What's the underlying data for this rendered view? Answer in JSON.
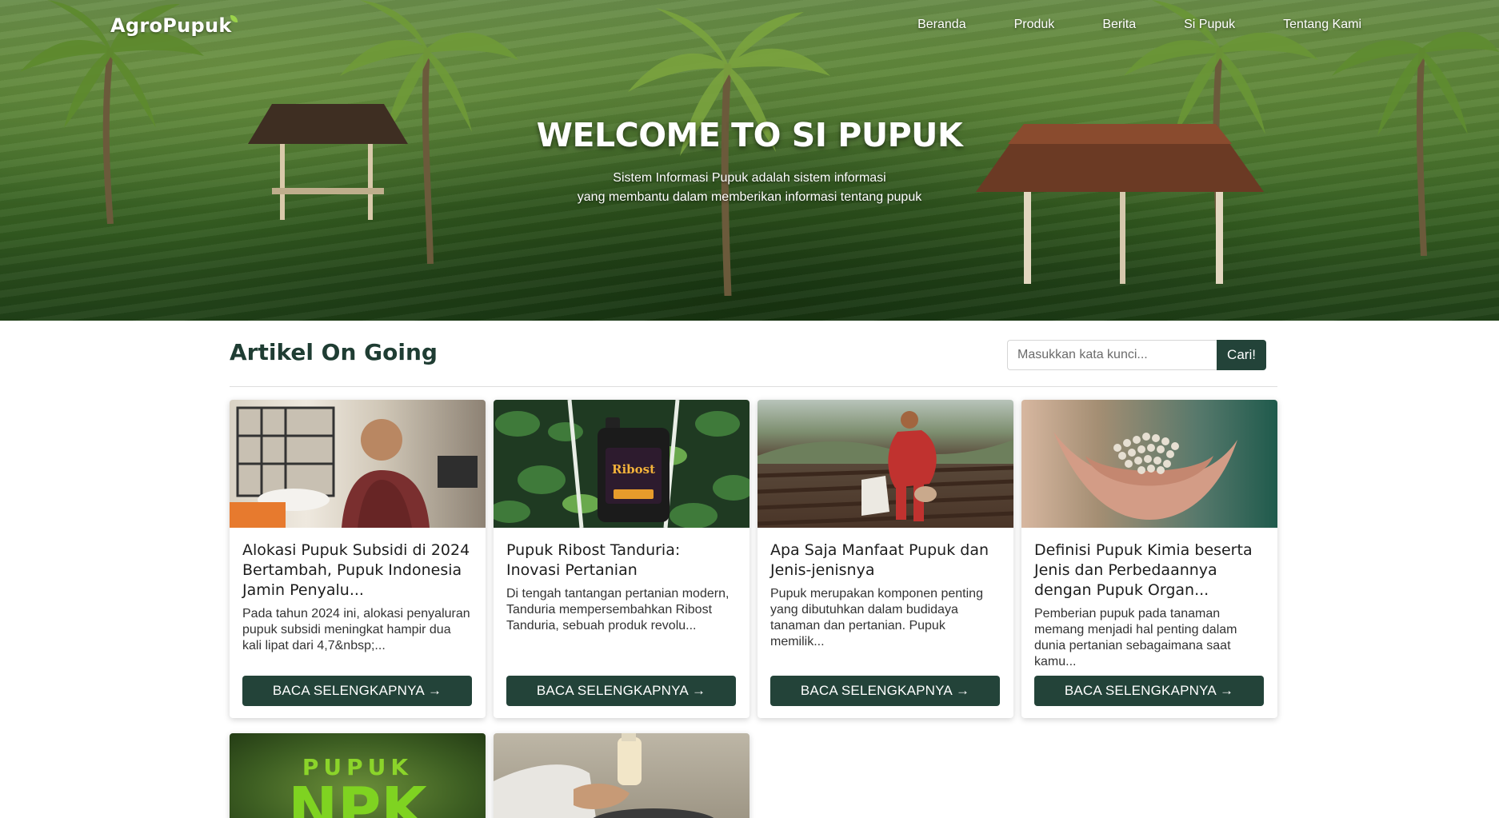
{
  "brand": {
    "name": "AgroPupuk"
  },
  "nav": {
    "items": [
      {
        "label": "Beranda"
      },
      {
        "label": "Produk"
      },
      {
        "label": "Berita"
      },
      {
        "label": "Si Pupuk"
      },
      {
        "label": "Tentang Kami"
      }
    ]
  },
  "hero": {
    "title": "WELCOME TO SI PUPUK",
    "subtitle_line1": "Sistem Informasi Pupuk adalah sistem informasi",
    "subtitle_line2": "yang membantu dalam memberikan informasi tentang pupuk"
  },
  "section": {
    "title": "Artikel On Going"
  },
  "search": {
    "placeholder": "Masukkan kata kunci...",
    "button_label": "Cari!"
  },
  "colors": {
    "primary": "#234339",
    "heading": "#1f3d33"
  },
  "articles": [
    {
      "title": "Alokasi Pupuk Subsidi di 2024 Bertambah, Pupuk Indonesia Jamin Penyalu...",
      "excerpt": "Pada tahun 2024 ini, alokasi penyaluran pupuk subsidi meningkat hampir dua kali lipat dari 4,7&nbsp;...",
      "button_label": "BACA SELENGKAPNYA →"
    },
    {
      "title": "Pupuk Ribost Tanduria: Inovasi Pertanian",
      "excerpt": "Di tengah tantangan pertanian modern, Tanduria mempersembahkan Ribost Tanduria, sebuah produk revolu...",
      "button_label": "BACA SELENGKAPNYA →",
      "thumb_text_line1": "Ribost"
    },
    {
      "title": "Apa Saja Manfaat Pupuk dan Jenis-jenisnya",
      "excerpt": "Pupuk merupakan komponen penting yang dibutuhkan dalam budidaya tanaman dan pertanian. Pupuk memilik...",
      "button_label": "BACA SELENGKAPNYA →"
    },
    {
      "title": "Definisi Pupuk Kimia beserta Jenis dan Perbedaannya dengan Pupuk Organ...",
      "excerpt": "Pemberian pupuk pada tanaman memang menjadi hal penting dalam dunia pertanian sebagaimana saat kamu...",
      "button_label": "BACA SELENGKAPNYA →"
    },
    {
      "thumb_text_line1": "PUPUK",
      "thumb_text_line2": "NPK"
    },
    {}
  ]
}
